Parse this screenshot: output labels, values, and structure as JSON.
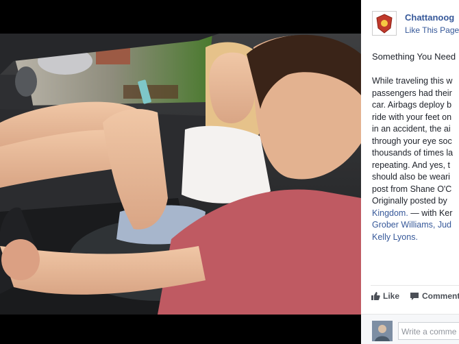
{
  "page": {
    "name": "Chattanoog",
    "like_label": "Like This Page"
  },
  "post": {
    "title": "Something You Need",
    "lines": [
      "While traveling this w",
      "passengers had their",
      "car. Airbags deploy b",
      "ride with your feet on",
      "in an accident, the ai",
      "through your eye soc",
      "thousands of times la",
      "repeating. And yes, t",
      "should also be weari",
      "post from Shane O'C"
    ],
    "originally_prefix": "Originally posted by",
    "kingdom_link": "Kingdom.",
    "with_label": "— with Ker",
    "tag_line": "Grober Williams, Jud",
    "last_tag": "Kelly Lyons."
  },
  "actions": {
    "like": "Like",
    "comment": "Comment"
  },
  "comment_box": {
    "placeholder": "Write a comme"
  },
  "colors": {
    "link": "#365899",
    "photo_bg": "#000000",
    "logo_red": "#c0392b"
  }
}
